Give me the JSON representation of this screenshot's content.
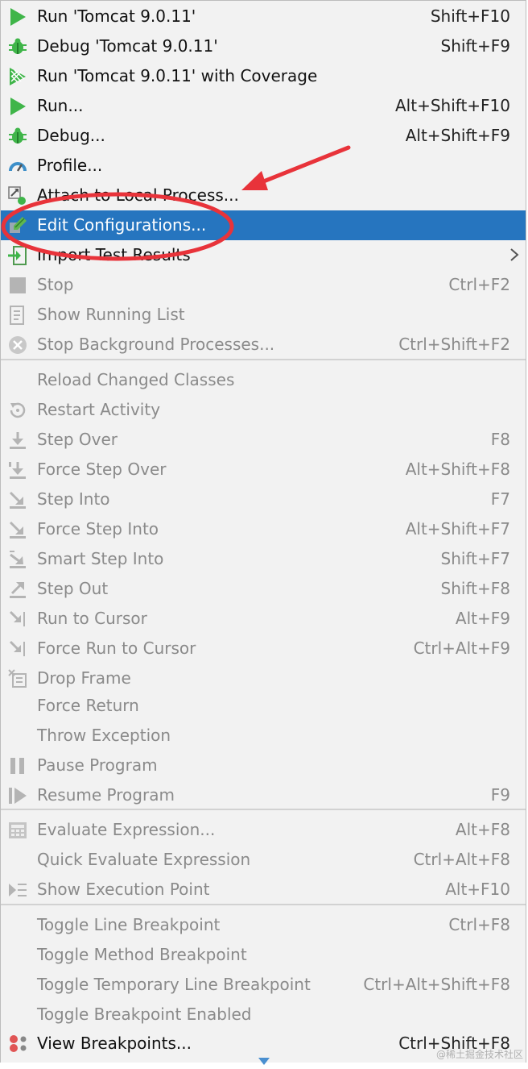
{
  "menu": {
    "items": [
      {
        "label": "Run 'Tomcat 9.0.11'",
        "shortcut": "Shift+F10",
        "icon": "run-icon",
        "enabled": true
      },
      {
        "label": "Debug 'Tomcat 9.0.11'",
        "shortcut": "Shift+F9",
        "icon": "debug-icon",
        "enabled": true
      },
      {
        "label": "Run 'Tomcat 9.0.11' with Coverage",
        "shortcut": "",
        "icon": "coverage-icon",
        "enabled": true
      },
      {
        "label": "Run...",
        "shortcut": "Alt+Shift+F10",
        "icon": "run-icon",
        "enabled": true
      },
      {
        "label": "Debug...",
        "shortcut": "Alt+Shift+F9",
        "icon": "debug-icon",
        "enabled": true
      },
      {
        "label": "Profile...",
        "shortcut": "",
        "icon": "profile-icon",
        "enabled": true
      },
      {
        "label": "Attach to Local Process...",
        "shortcut": "",
        "icon": "attach-icon",
        "enabled": true
      },
      {
        "label": "Edit Configurations...",
        "shortcut": "",
        "icon": "edit-config-icon",
        "enabled": true,
        "selected": true
      },
      {
        "label": "Import Test Results",
        "shortcut": "",
        "icon": "import-icon",
        "enabled": true,
        "submenu": true
      },
      {
        "label": "Stop",
        "shortcut": "Ctrl+F2",
        "icon": "stop-icon",
        "enabled": false
      },
      {
        "label": "Show Running List",
        "shortcut": "",
        "icon": "running-list-icon",
        "enabled": false
      },
      {
        "label": "Stop Background Processes...",
        "shortcut": "Ctrl+Shift+F2",
        "icon": "stop-background-icon",
        "enabled": false
      },
      {
        "label": "Reload Changed Classes",
        "shortcut": "",
        "icon": "",
        "enabled": false
      },
      {
        "label": "Restart Activity",
        "shortcut": "",
        "icon": "restart-icon",
        "enabled": false
      },
      {
        "label": "Step Over",
        "shortcut": "F8",
        "icon": "step-over-icon",
        "enabled": false
      },
      {
        "label": "Force Step Over",
        "shortcut": "Alt+Shift+F8",
        "icon": "force-step-over-icon",
        "enabled": false
      },
      {
        "label": "Step Into",
        "shortcut": "F7",
        "icon": "step-into-icon",
        "enabled": false
      },
      {
        "label": "Force Step Into",
        "shortcut": "Alt+Shift+F7",
        "icon": "force-step-into-icon",
        "enabled": false
      },
      {
        "label": "Smart Step Into",
        "shortcut": "Shift+F7",
        "icon": "smart-step-into-icon",
        "enabled": false
      },
      {
        "label": "Step Out",
        "shortcut": "Shift+F8",
        "icon": "step-out-icon",
        "enabled": false
      },
      {
        "label": "Run to Cursor",
        "shortcut": "Alt+F9",
        "icon": "run-to-cursor-icon",
        "enabled": false
      },
      {
        "label": "Force Run to Cursor",
        "shortcut": "Ctrl+Alt+F9",
        "icon": "force-run-to-cursor-icon",
        "enabled": false
      },
      {
        "label": "Drop Frame",
        "shortcut": "",
        "icon": "drop-frame-icon",
        "enabled": false
      },
      {
        "label": "Force Return",
        "shortcut": "",
        "icon": "",
        "enabled": false
      },
      {
        "label": "Throw Exception",
        "shortcut": "",
        "icon": "",
        "enabled": false
      },
      {
        "label": "Pause Program",
        "shortcut": "",
        "icon": "pause-icon",
        "enabled": false
      },
      {
        "label": "Resume Program",
        "shortcut": "F9",
        "icon": "resume-icon",
        "enabled": false
      },
      {
        "label": "Evaluate Expression...",
        "shortcut": "Alt+F8",
        "icon": "evaluate-icon",
        "enabled": false
      },
      {
        "label": "Quick Evaluate Expression",
        "shortcut": "Ctrl+Alt+F8",
        "icon": "",
        "enabled": false
      },
      {
        "label": "Show Execution Point",
        "shortcut": "Alt+F10",
        "icon": "execution-point-icon",
        "enabled": false
      },
      {
        "label": "Toggle Line Breakpoint",
        "shortcut": "Ctrl+F8",
        "icon": "",
        "enabled": false
      },
      {
        "label": "Toggle Method Breakpoint",
        "shortcut": "",
        "icon": "",
        "enabled": false
      },
      {
        "label": "Toggle Temporary Line Breakpoint",
        "shortcut": "Ctrl+Alt+Shift+F8",
        "icon": "",
        "enabled": false
      },
      {
        "label": "Toggle Breakpoint Enabled",
        "shortcut": "",
        "icon": "",
        "enabled": false
      },
      {
        "label": "View Breakpoints...",
        "shortcut": "Ctrl+Shift+F8",
        "icon": "view-breakpoints-icon",
        "enabled": true
      }
    ]
  },
  "watermark": "@稀土掘金技术社区",
  "colors": {
    "selection": "#2675bf",
    "menu_bg": "#f2f2f2",
    "annotation_red": "#e8333a",
    "run_green": "#3fb549"
  }
}
